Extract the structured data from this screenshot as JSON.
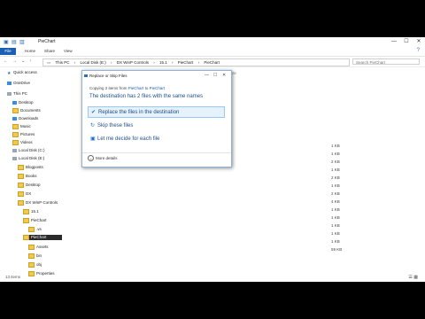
{
  "window": {
    "title": "PieChart",
    "controls": [
      "—",
      "☐",
      "✕"
    ]
  },
  "ribbon": {
    "tabs": [
      "File",
      "Home",
      "Share",
      "View"
    ],
    "help": "?"
  },
  "address": {
    "crumbs": [
      "This PC",
      "›",
      "Local Disk (E:)",
      "›",
      "DX WinP Controls",
      "›",
      "15.1",
      "›",
      "PieChart",
      "›",
      "PieChart"
    ],
    "search_placeholder": "Search PieChart"
  },
  "nav": {
    "items": [
      {
        "label": "Quick access",
        "icon": "star-icon"
      },
      {
        "label": "OneDrive",
        "icon": "cloud-icon"
      },
      {
        "label": "This PC",
        "icon": "pc-icon"
      },
      {
        "label": "Desktop",
        "icon": "folder-icon"
      },
      {
        "label": "Documents",
        "icon": "folder-icon"
      },
      {
        "label": "Downloads",
        "icon": "folder-icon"
      },
      {
        "label": "Music",
        "icon": "folder-icon"
      },
      {
        "label": "Pictures",
        "icon": "folder-icon"
      },
      {
        "label": "Videos",
        "icon": "folder-icon"
      },
      {
        "label": "Local Disk (C:)",
        "icon": "drive-icon"
      },
      {
        "label": "Local Disk (E:)",
        "icon": "drive-icon"
      },
      {
        "label": "Blogposts",
        "icon": "folder-icon"
      },
      {
        "label": "Books",
        "icon": "folder-icon"
      },
      {
        "label": "Desktop",
        "icon": "folder-icon"
      },
      {
        "label": "DX",
        "icon": "folder-icon"
      },
      {
        "label": "DX WinP Controls",
        "icon": "folder-icon"
      },
      {
        "label": "15.1",
        "icon": "folder-icon"
      },
      {
        "label": "PieChart",
        "icon": "folder-icon"
      },
      {
        "label": ".vs",
        "icon": "folder-icon"
      },
      {
        "label": "PieChart",
        "icon": "folder-icon"
      },
      {
        "label": "Assets",
        "icon": "folder-icon"
      },
      {
        "label": "bin",
        "icon": "folder-icon"
      },
      {
        "label": "obj",
        "icon": "folder-icon"
      },
      {
        "label": "Properties",
        "icon": "folder-icon"
      }
    ]
  },
  "content": {
    "size_header": "Size",
    "sizes": [
      "1 KB",
      "1 KB",
      "2 KB",
      "1 KB",
      "2 KB",
      "1 KB",
      "2 KB",
      "4 KB",
      "1 KB",
      "1 KB",
      "1 KB",
      "1 KB",
      "1 KB",
      "59 KB"
    ]
  },
  "status": {
    "items": "13 items"
  },
  "dialog": {
    "title": "Replace or Skip Files",
    "copying_prefix": "Copying 2 items from",
    "source": "PieChart",
    "to": "to",
    "dest": "PieChart",
    "heading": "The destination has 2 files with the same names",
    "options": [
      "Replace the files in the destination",
      "Skip these files",
      "Let me decide for each file"
    ],
    "more_details": "More details"
  }
}
